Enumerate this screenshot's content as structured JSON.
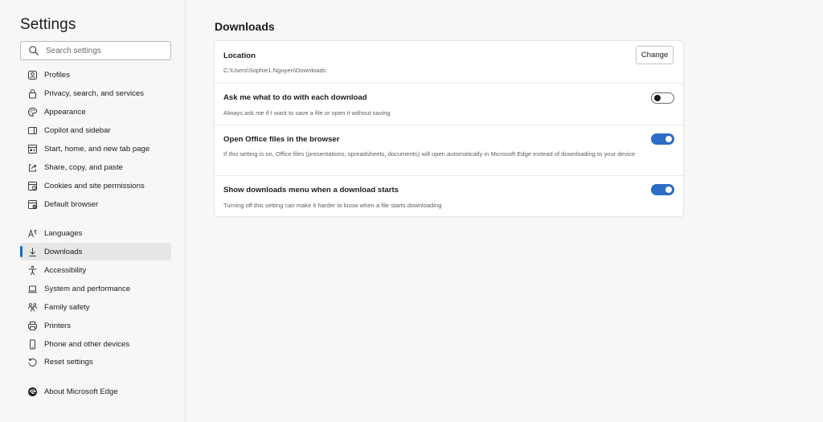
{
  "sidebar": {
    "title": "Settings",
    "search": {
      "placeholder": "Search settings",
      "value": ""
    },
    "items": [
      {
        "label": "Profiles",
        "icon": "profile-icon"
      },
      {
        "label": "Privacy, search, and services",
        "icon": "lock-icon"
      },
      {
        "label": "Appearance",
        "icon": "palette-icon"
      },
      {
        "label": "Copilot and sidebar",
        "icon": "sidebar-icon"
      },
      {
        "label": "Start, home, and new tab page",
        "icon": "home-grid-icon"
      },
      {
        "label": "Share, copy, and paste",
        "icon": "share-icon"
      },
      {
        "label": "Cookies and site permissions",
        "icon": "cookie-permissions-icon"
      },
      {
        "label": "Default browser",
        "icon": "default-browser-icon"
      },
      {
        "label": "Languages",
        "icon": "languages-icon"
      },
      {
        "label": "Downloads",
        "icon": "download-icon",
        "active": true
      },
      {
        "label": "Accessibility",
        "icon": "accessibility-icon"
      },
      {
        "label": "System and performance",
        "icon": "laptop-icon"
      },
      {
        "label": "Family safety",
        "icon": "family-icon"
      },
      {
        "label": "Printers",
        "icon": "printer-icon"
      },
      {
        "label": "Phone and other devices",
        "icon": "phone-icon"
      },
      {
        "label": "Reset settings",
        "icon": "reset-icon"
      },
      {
        "label": "About Microsoft Edge",
        "icon": "edge-logo-icon"
      }
    ]
  },
  "main": {
    "title": "Downloads",
    "location": {
      "title": "Location",
      "path": "C:\\Users\\Sophie1.Nguyen\\Downloads",
      "button_label": "Change"
    },
    "ask_download": {
      "title": "Ask me what to do with each download",
      "description": "Always ask me if I want to save a file or open it without saving",
      "enabled": false
    },
    "office_files": {
      "title": "Open Office files in the browser",
      "description": "If this setting is on, Office files (presentations, spreadsheets, documents) will open automatically in Microsoft Edge instead of downloading to your device",
      "enabled": true
    },
    "downloads_menu": {
      "title": "Show downloads menu when a download starts",
      "description": "Turning off this setting can make it harder to know when a file starts downloading",
      "enabled": true
    }
  },
  "colors": {
    "accent": "#0f6cbd",
    "toggle_on": "#2b6cc4",
    "background": "#f7f7f7",
    "card": "#ffffff"
  }
}
